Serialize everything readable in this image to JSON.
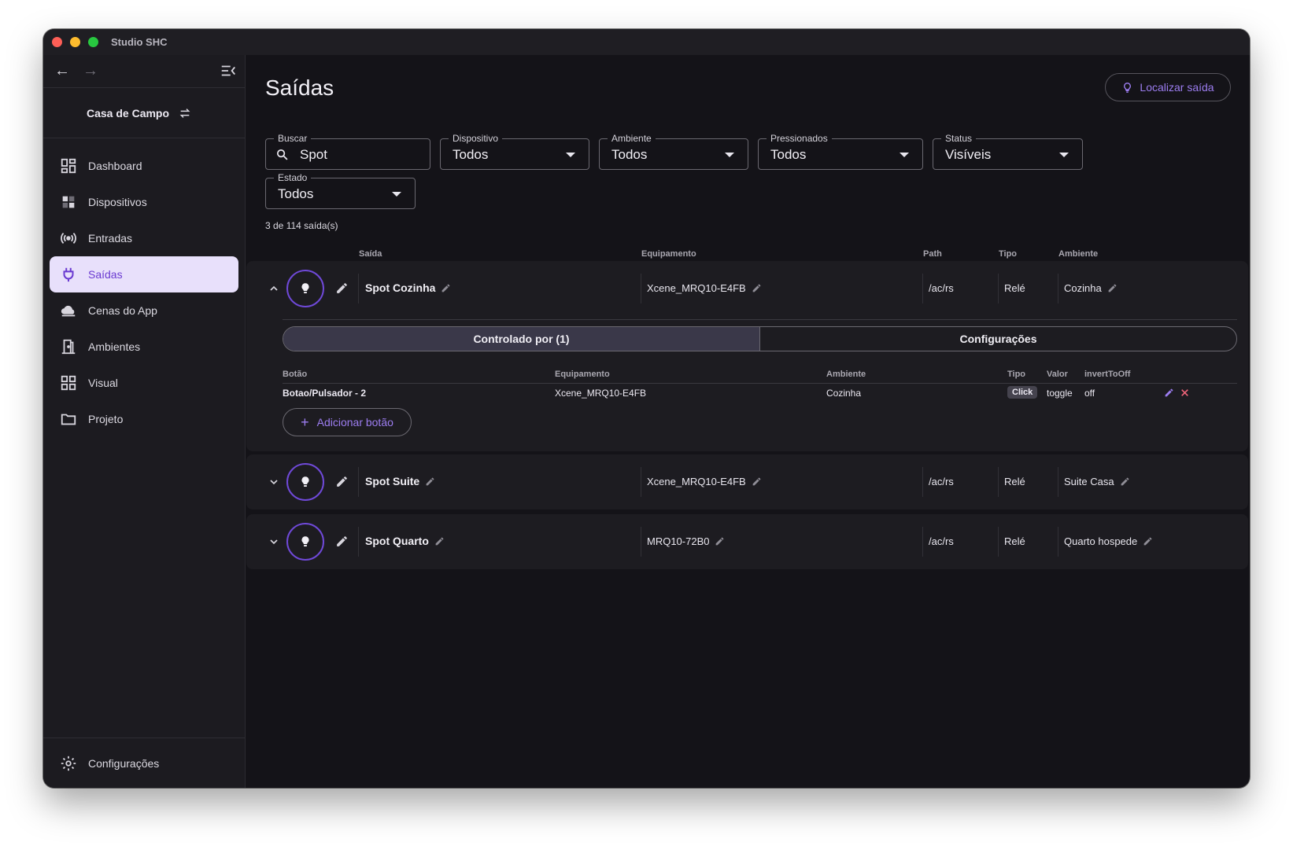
{
  "window": {
    "title": "Studio SHC"
  },
  "sidebar": {
    "project": "Casa de Campo",
    "items": [
      {
        "label": "Dashboard",
        "icon": "dashboard-icon"
      },
      {
        "label": "Dispositivos",
        "icon": "devices-icon"
      },
      {
        "label": "Entradas",
        "icon": "broadcast-icon"
      },
      {
        "label": "Saídas",
        "icon": "plug-icon",
        "active": true
      },
      {
        "label": "Cenas do App",
        "icon": "cloud-icon"
      },
      {
        "label": "Ambientes",
        "icon": "door-icon"
      },
      {
        "label": "Visual",
        "icon": "grid-icon"
      },
      {
        "label": "Projeto",
        "icon": "folder-icon"
      }
    ],
    "settings": "Configurações"
  },
  "page": {
    "title": "Saídas",
    "locate_button": "Localizar saída",
    "accent": "#9c7df0"
  },
  "filters": {
    "search": {
      "label": "Buscar",
      "value": "Spot"
    },
    "device": {
      "label": "Dispositivo",
      "value": "Todos"
    },
    "room": {
      "label": "Ambiente",
      "value": "Todos"
    },
    "pressed": {
      "label": "Pressionados",
      "value": "Todos"
    },
    "status": {
      "label": "Status",
      "value": "Visíveis"
    },
    "state": {
      "label": "Estado",
      "value": "Todos"
    }
  },
  "count_text": "3 de 114 saída(s)",
  "table": {
    "headers": {
      "output": "Saída",
      "equipment": "Equipamento",
      "path": "Path",
      "type": "Tipo",
      "room": "Ambiente"
    },
    "rows": [
      {
        "name": "Spot Cozinha",
        "equipment": "Xcene_MRQ10-E4FB",
        "path": "/ac/rs",
        "type": "Relé",
        "room": "Cozinha",
        "expanded": true
      },
      {
        "name": "Spot Suite",
        "equipment": "Xcene_MRQ10-E4FB",
        "path": "/ac/rs",
        "type": "Relé",
        "room": "Suite Casa",
        "expanded": false
      },
      {
        "name": "Spot Quarto",
        "equipment": "MRQ10-72B0",
        "path": "/ac/rs",
        "type": "Relé",
        "room": "Quarto hospede",
        "expanded": false
      }
    ]
  },
  "expanded": {
    "tabs": {
      "controlled": "Controlado por (1)",
      "config": "Configurações"
    },
    "headers": {
      "button": "Botão",
      "equipment": "Equipamento",
      "room": "Ambiente",
      "type": "Tipo",
      "value": "Valor",
      "invert": "invertToOff"
    },
    "rows": [
      {
        "button": "Botao/Pulsador - 2",
        "equipment": "Xcene_MRQ10-E4FB",
        "room": "Cozinha",
        "type": "Click",
        "value": "toggle",
        "invert": "off"
      }
    ],
    "add_button": "Adicionar botão"
  }
}
